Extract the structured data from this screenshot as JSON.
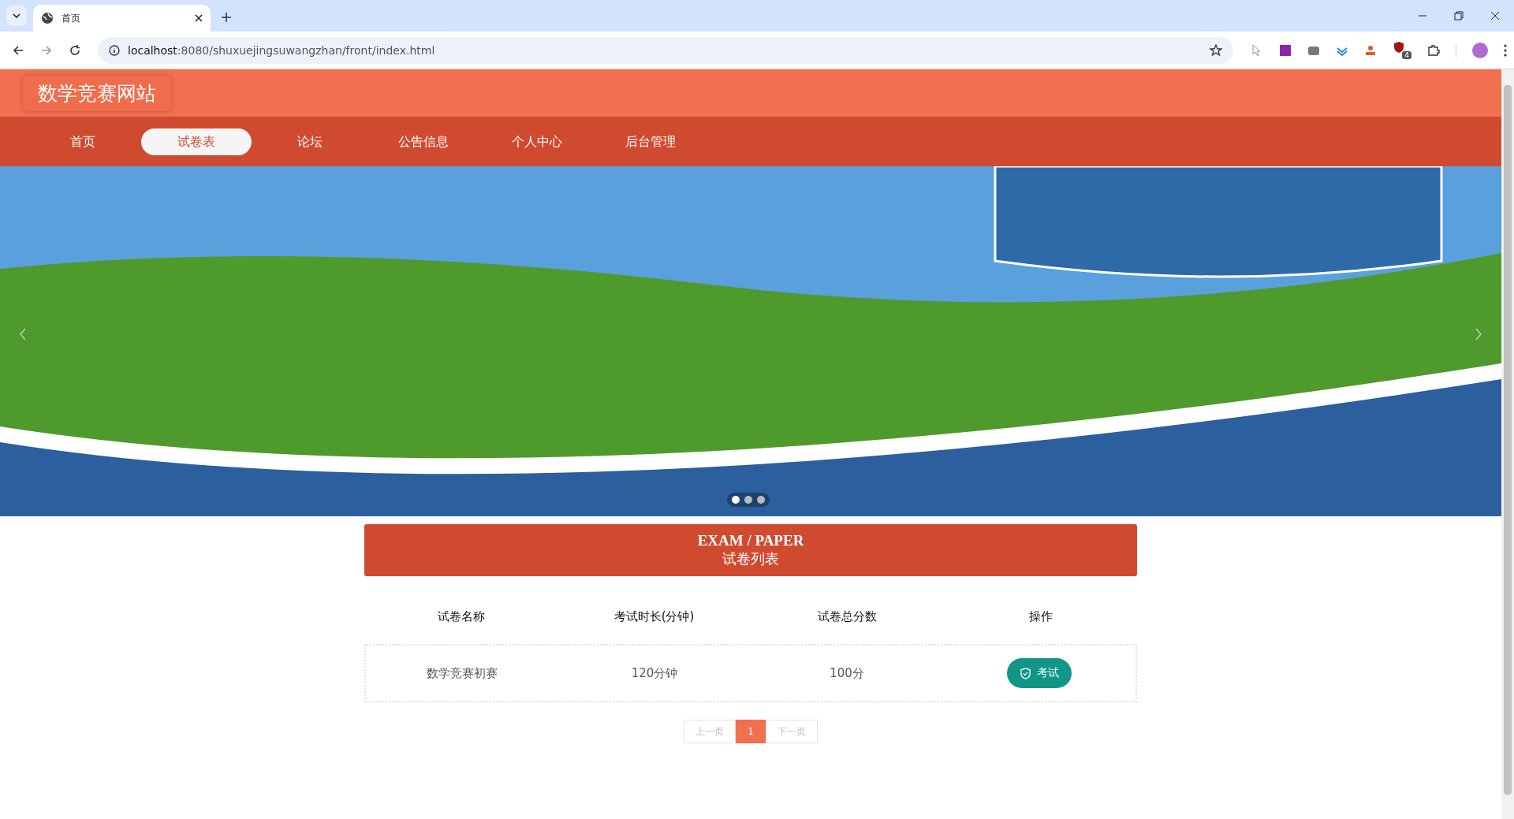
{
  "browser": {
    "tab_title": "首页",
    "url_host": "localhost",
    "url_rest": ":8080/shuxuejingsuwangzhan/front/index.html",
    "extension_badge": "4"
  },
  "site": {
    "title": "数学竞赛网站"
  },
  "nav": [
    {
      "label": "首页",
      "selected": false
    },
    {
      "label": "试卷表",
      "selected": true
    },
    {
      "label": "论坛",
      "selected": false
    },
    {
      "label": "公告信息",
      "selected": false
    },
    {
      "label": "个人中心",
      "selected": false
    },
    {
      "label": "后台管理",
      "selected": false
    }
  ],
  "carousel": {
    "dots": [
      {
        "selected": true
      },
      {
        "selected": false
      },
      {
        "selected": false
      }
    ]
  },
  "section": {
    "title_en": "EXAM / PAPER",
    "title_zh": "试卷列表"
  },
  "table": {
    "columns": [
      "试卷名称",
      "考试时长(分钟)",
      "试卷总分数",
      "操作"
    ],
    "rows": [
      {
        "name": "数学竞赛初赛",
        "duration": "120分钟",
        "score": "100分",
        "action": "考试"
      }
    ]
  },
  "pagination": {
    "prev": "上一页",
    "pages": [
      {
        "label": "1",
        "selected": true
      }
    ],
    "next": "下一页"
  }
}
